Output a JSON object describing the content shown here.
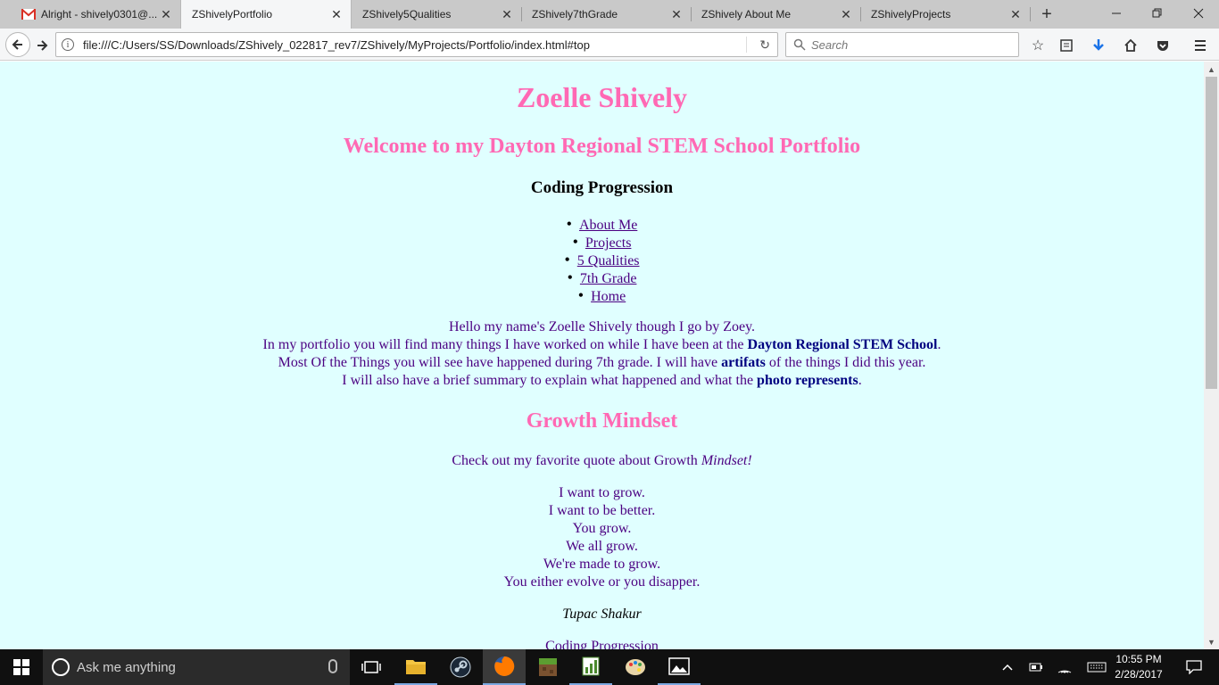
{
  "browser": {
    "tabs": [
      {
        "title": "Alright - shively0301@...",
        "icon": "gmail-icon"
      },
      {
        "title": "ZShivelyPortfolio",
        "active": true
      },
      {
        "title": "ZShively5Qualities"
      },
      {
        "title": "ZShively7thGrade"
      },
      {
        "title": "ZShively About Me"
      },
      {
        "title": "ZShivelyProjects"
      }
    ],
    "url": "file:///C:/Users/SS/Downloads/ZShively_022817_rev7/ZShively/MyProjects/Portfolio/index.html#top",
    "search_placeholder": "Search"
  },
  "page": {
    "title": "Zoelle Shively",
    "subtitle": "Welcome to my Dayton Regional STEM School Portfolio",
    "section_heading": "Coding Progression",
    "nav_links": [
      "About Me",
      "Projects",
      "5 Qualities",
      "7th Grade",
      "Home"
    ],
    "intro": {
      "line1": "Hello my name's Zoelle Shively though I go by Zoey.",
      "line2_pre": "In my portfolio you will find many things I have worked on while I have been at the ",
      "line2_bold": "Dayton Regional STEM School",
      "line2_post": ".",
      "line3_pre": "Most Of the Things you will see have happened during 7th grade. I will have ",
      "line3_bold": "artifats",
      "line3_post": " of the things I did this year.",
      "line4_pre": "I will also have a brief summary to explain what happened and what the ",
      "line4_bold": "photo represents",
      "line4_post": "."
    },
    "growth_heading": "Growth Mindset",
    "quote_intro_pre": "Check out my favorite quote about Growth ",
    "quote_intro_em": "Mindset!",
    "quote_lines": [
      "I want to grow.",
      "I want to be better.",
      "You grow.",
      "We all grow.",
      "We're made to grow.",
      "You either evolve or you disapper."
    ],
    "quote_author": "Tupac Shakur",
    "footer_text": "Coding Progression"
  },
  "taskbar": {
    "search_text": "Ask me anything",
    "time": "10:55 PM",
    "date": "2/28/2017"
  },
  "colors": {
    "page_background": "#e0ffff",
    "heading_pink": "#ff69b4",
    "text_indigo": "#4b0082"
  }
}
